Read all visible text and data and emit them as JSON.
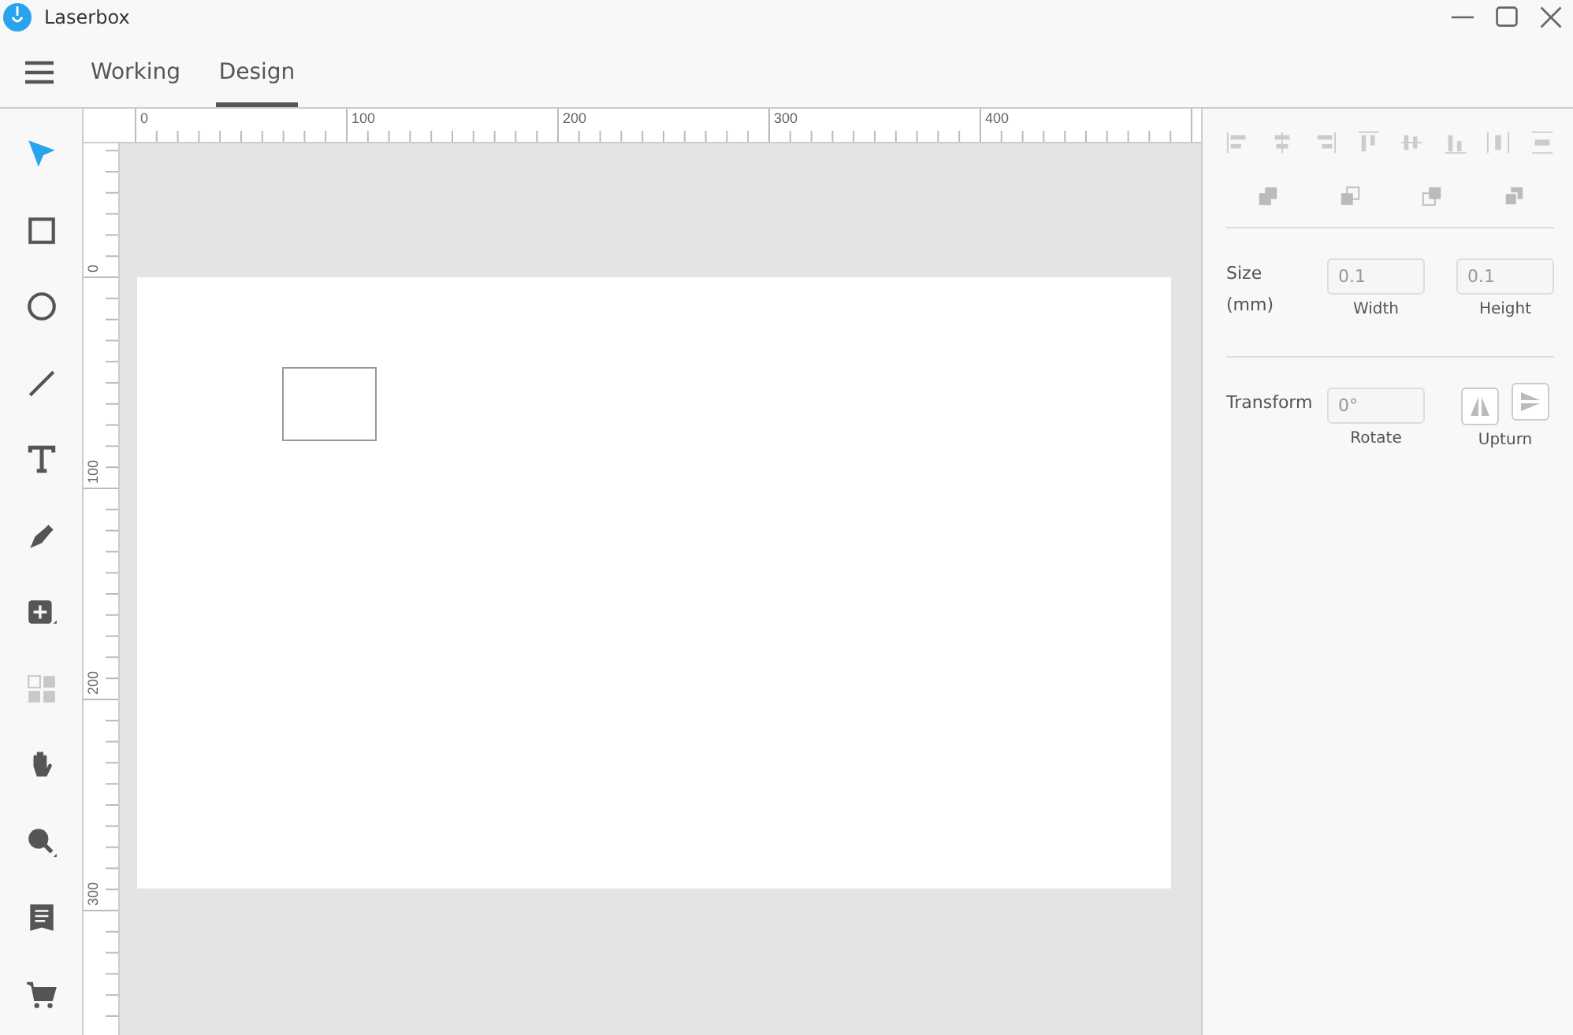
{
  "window": {
    "title": "Laserbox"
  },
  "tabs": [
    {
      "label": "Working",
      "selected": false
    },
    {
      "label": "Design",
      "selected": true
    }
  ],
  "tools": [
    {
      "kind": "select",
      "selected": true,
      "disabled": false
    },
    {
      "kind": "rectangle",
      "selected": false,
      "disabled": false
    },
    {
      "kind": "ellipse",
      "selected": false,
      "disabled": false
    },
    {
      "kind": "line",
      "selected": false,
      "disabled": false
    },
    {
      "kind": "text",
      "selected": false,
      "disabled": false
    },
    {
      "kind": "pen",
      "selected": false,
      "disabled": false
    },
    {
      "kind": "add",
      "selected": false,
      "disabled": false
    },
    {
      "kind": "grid",
      "selected": false,
      "disabled": true
    },
    {
      "kind": "hand",
      "selected": false,
      "disabled": false
    },
    {
      "kind": "zoom",
      "selected": false,
      "disabled": false
    },
    {
      "kind": "book",
      "selected": false,
      "disabled": false
    },
    {
      "kind": "cart",
      "selected": false,
      "disabled": false
    }
  ],
  "ruler": {
    "horizontal_labels": [
      "0",
      "100",
      "200",
      "300",
      "400"
    ],
    "vertical_labels": [
      "0",
      "100",
      "200",
      "300"
    ]
  },
  "panel": {
    "align_buttons": [
      {
        "kind": "left"
      },
      {
        "kind": "hcenter"
      },
      {
        "kind": "right"
      },
      {
        "kind": "top"
      },
      {
        "kind": "vcenter"
      },
      {
        "kind": "bottom"
      },
      {
        "kind": "hdistribute"
      },
      {
        "kind": "vdistribute"
      }
    ],
    "arrange_buttons": [
      {
        "kind": "front"
      },
      {
        "kind": "forward"
      },
      {
        "kind": "backward"
      },
      {
        "kind": "back"
      }
    ],
    "size": {
      "label": "Size",
      "unit": "(mm)",
      "width": {
        "value": "0.1",
        "caption": "Width",
        "disabled": true
      },
      "height": {
        "value": "0.1",
        "caption": "Height",
        "disabled": true
      }
    },
    "transform": {
      "label": "Transform",
      "rotate": {
        "value": "0°",
        "caption": "Rotate",
        "disabled": true
      },
      "upturn_caption": "Upturn"
    }
  }
}
